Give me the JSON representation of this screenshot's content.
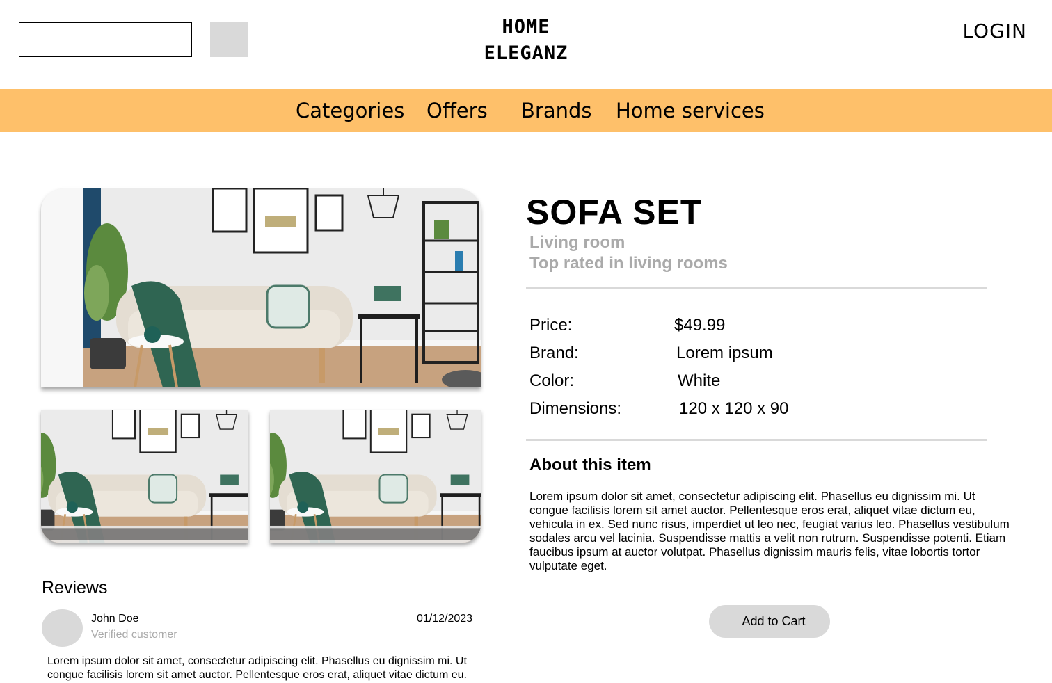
{
  "header": {
    "brand_line1": "HOME",
    "brand_line2": "ELEGANZ",
    "login_label": "LOGIN"
  },
  "nav": {
    "background": "#fec06a",
    "items": [
      "Categories",
      "Offers",
      "Brands",
      "Home services"
    ]
  },
  "product": {
    "title": "SOFA SET",
    "category": "Living room",
    "tagline": "Top rated in living rooms",
    "specs": [
      {
        "label": "Price:",
        "value": "$49.99"
      },
      {
        "label": "Brand:",
        "value": "Lorem ipsum"
      },
      {
        "label": "Color:",
        "value": "White"
      },
      {
        "label": "Dimensions:",
        "value": "120 x 120 x 90"
      }
    ],
    "about_heading": "About this item",
    "about_text": "Lorem ipsum dolor sit amet, consectetur adipiscing elit. Phasellus eu dignissim mi. Ut congue facilisis lorem sit amet auctor. Pellentesque eros erat, aliquet vitae dictum eu, vehicula in ex. Sed nunc risus, imperdiet ut leo nec, feugiat varius leo. Phasellus vestibulum sodales arcu vel lacinia. Suspendisse mattis a velit non rutrum. Suspendisse potenti. Etiam faucibus ipsum at auctor volutpat. Phasellus dignissim mauris felis, vitae lobortis tortor vulputate eget.",
    "add_to_cart_label": "Add to Cart"
  },
  "reviews": {
    "heading": "Reviews",
    "items": [
      {
        "name": "John Doe",
        "role": "Verified customer",
        "date": "01/12/2023",
        "text": "Lorem ipsum dolor sit amet, consectetur adipiscing elit. Phasellus eu dignissim mi. Ut congue facilisis lorem sit amet auctor. Pellentesque eros erat, aliquet vitae dictum eu."
      }
    ]
  },
  "colors": {
    "accent": "#fec06a",
    "muted_text": "#aaaaaa",
    "placeholder_gray": "#d9d9d9"
  }
}
